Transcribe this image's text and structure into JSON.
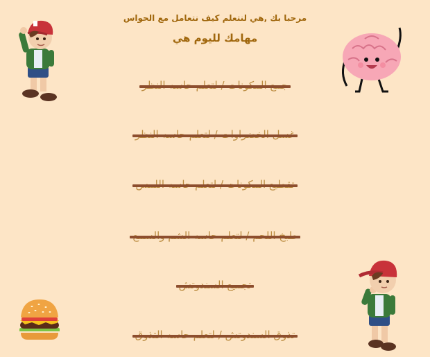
{
  "header": {
    "welcome": "مرحبا بك ,هي لنتعلم كيف نتعامل مع الحواس",
    "tasks_title": "مهامك لليوم هي"
  },
  "tasks": [
    {
      "label": "جمع المكونات / لتعلم حاسه النظر",
      "completed": true
    },
    {
      "label": "غسل الخضراوات / لتعلم حاسه النظر",
      "completed": true
    },
    {
      "label": "تقطيع المكونات / لتعلم حاسه اللمس",
      "completed": true
    },
    {
      "label": "طبخ اللحم / لتعلم حاسه الشم والسمع",
      "completed": true
    },
    {
      "label": "تجميع السندوتش",
      "completed": true
    },
    {
      "label": "تذوق السندوتش / لتعلم حاسه التذوق",
      "completed": true
    }
  ],
  "icons": {
    "boy_top": "boy-character",
    "brain": "brain-character",
    "boy_bottom": "boy-character",
    "burger": "burger"
  },
  "colors": {
    "background": "#fde5c6",
    "text": "#a0670d",
    "strike": "#7a3414"
  }
}
